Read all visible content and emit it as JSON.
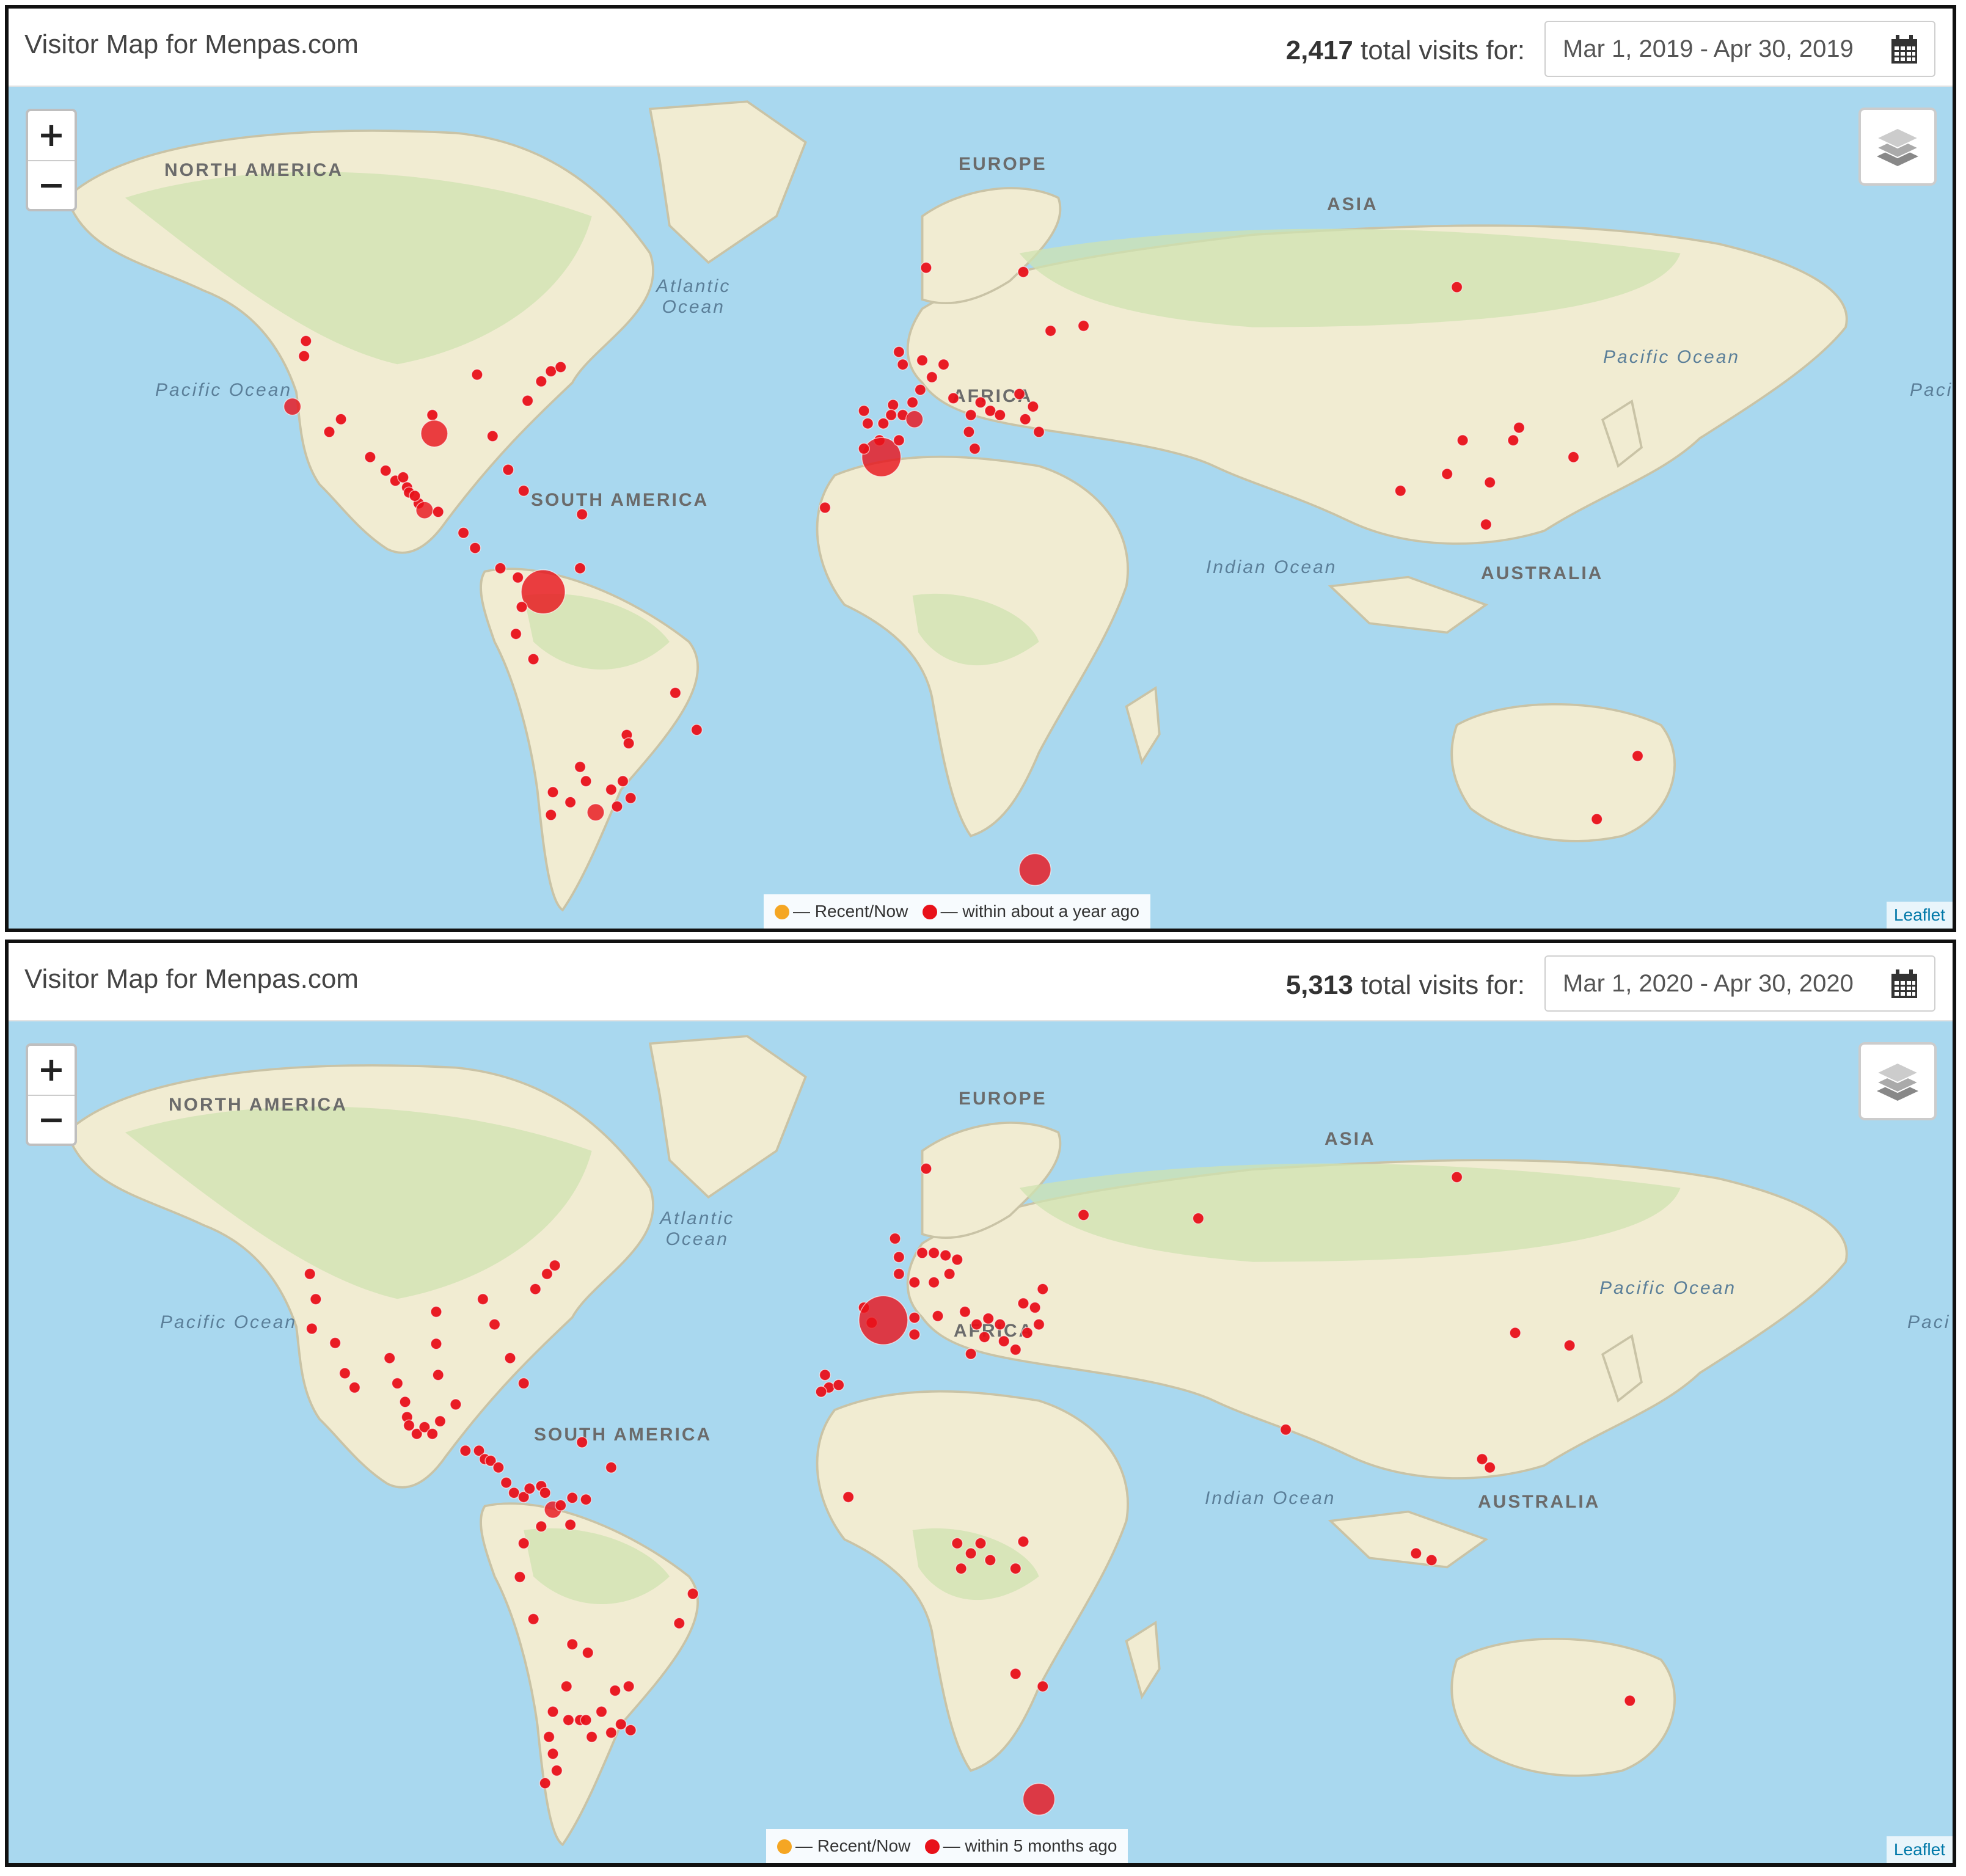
{
  "panels": [
    {
      "title": "Visitor Map for Menpas.com",
      "visits_count": "2,417",
      "visits_suffix": "total visits for:",
      "date_range": "Mar 1, 2019 - Apr 30, 2019",
      "legend": {
        "recent": "— Recent/Now",
        "older": "— within about a year ago"
      },
      "attribution": "Leaflet",
      "markers": [
        [
          0.152,
          0.32,
          1
        ],
        [
          0.153,
          0.302,
          1
        ],
        [
          0.146,
          0.38,
          2
        ],
        [
          0.171,
          0.395,
          1
        ],
        [
          0.165,
          0.41,
          1
        ],
        [
          0.186,
          0.44,
          1
        ],
        [
          0.194,
          0.456,
          1
        ],
        [
          0.199,
          0.468,
          1
        ],
        [
          0.203,
          0.464,
          1
        ],
        [
          0.205,
          0.476,
          1
        ],
        [
          0.206,
          0.482,
          1
        ],
        [
          0.211,
          0.495,
          1
        ],
        [
          0.214,
          0.503,
          2
        ],
        [
          0.209,
          0.486,
          1
        ],
        [
          0.221,
          0.505,
          1
        ],
        [
          0.218,
          0.39,
          1
        ],
        [
          0.219,
          0.412,
          3
        ],
        [
          0.241,
          0.342,
          1
        ],
        [
          0.249,
          0.415,
          1
        ],
        [
          0.257,
          0.455,
          1
        ],
        [
          0.267,
          0.373,
          1
        ],
        [
          0.274,
          0.35,
          1
        ],
        [
          0.279,
          0.338,
          1
        ],
        [
          0.284,
          0.333,
          1
        ],
        [
          0.265,
          0.48,
          1
        ],
        [
          0.295,
          0.508,
          1
        ],
        [
          0.234,
          0.53,
          1
        ],
        [
          0.24,
          0.548,
          1
        ],
        [
          0.253,
          0.572,
          1
        ],
        [
          0.262,
          0.583,
          1
        ],
        [
          0.275,
          0.6,
          5
        ],
        [
          0.264,
          0.618,
          1
        ],
        [
          0.261,
          0.65,
          1
        ],
        [
          0.294,
          0.572,
          1
        ],
        [
          0.27,
          0.68,
          1
        ],
        [
          0.343,
          0.72,
          1
        ],
        [
          0.354,
          0.764,
          1
        ],
        [
          0.318,
          0.77,
          1
        ],
        [
          0.319,
          0.78,
          1
        ],
        [
          0.297,
          0.825,
          1
        ],
        [
          0.289,
          0.85,
          1
        ],
        [
          0.294,
          0.808,
          1
        ],
        [
          0.279,
          0.865,
          1
        ],
        [
          0.302,
          0.862,
          2
        ],
        [
          0.31,
          0.835,
          1
        ],
        [
          0.313,
          0.855,
          1
        ],
        [
          0.32,
          0.845,
          1
        ],
        [
          0.316,
          0.825,
          1
        ],
        [
          0.28,
          0.838,
          1
        ],
        [
          0.472,
          0.215,
          1
        ],
        [
          0.458,
          0.315,
          1
        ],
        [
          0.46,
          0.33,
          1
        ],
        [
          0.47,
          0.325,
          1
        ],
        [
          0.481,
          0.33,
          1
        ],
        [
          0.475,
          0.345,
          1
        ],
        [
          0.469,
          0.36,
          1
        ],
        [
          0.465,
          0.375,
          1
        ],
        [
          0.455,
          0.378,
          1
        ],
        [
          0.44,
          0.385,
          1
        ],
        [
          0.442,
          0.4,
          1
        ],
        [
          0.45,
          0.4,
          1
        ],
        [
          0.454,
          0.39,
          1
        ],
        [
          0.46,
          0.39,
          1
        ],
        [
          0.466,
          0.395,
          2
        ],
        [
          0.448,
          0.42,
          1
        ],
        [
          0.449,
          0.44,
          6
        ],
        [
          0.44,
          0.43,
          1
        ],
        [
          0.458,
          0.42,
          1
        ],
        [
          0.42,
          0.5,
          1
        ],
        [
          0.486,
          0.37,
          1
        ],
        [
          0.495,
          0.39,
          1
        ],
        [
          0.5,
          0.375,
          1
        ],
        [
          0.505,
          0.385,
          1
        ],
        [
          0.51,
          0.39,
          1
        ],
        [
          0.52,
          0.365,
          1
        ],
        [
          0.527,
          0.38,
          1
        ],
        [
          0.523,
          0.395,
          1
        ],
        [
          0.536,
          0.29,
          1
        ],
        [
          0.522,
          0.22,
          1
        ],
        [
          0.494,
          0.41,
          1
        ],
        [
          0.497,
          0.43,
          1
        ],
        [
          0.53,
          0.41,
          1
        ],
        [
          0.553,
          0.284,
          1
        ],
        [
          0.745,
          0.238,
          1
        ],
        [
          0.777,
          0.405,
          1
        ],
        [
          0.748,
          0.42,
          1
        ],
        [
          0.716,
          0.48,
          1
        ],
        [
          0.74,
          0.46,
          1
        ],
        [
          0.762,
          0.47,
          1
        ],
        [
          0.76,
          0.52,
          1
        ],
        [
          0.774,
          0.42,
          1
        ],
        [
          0.805,
          0.44,
          1
        ],
        [
          0.838,
          0.795,
          1
        ],
        [
          0.817,
          0.87,
          1
        ],
        [
          0.528,
          0.93,
          4
        ]
      ]
    },
    {
      "title": "Visitor Map for Menpas.com",
      "visits_count": "5,313",
      "visits_suffix": "total visits for:",
      "date_range": "Mar 1, 2020 - Apr 30, 2020",
      "legend": {
        "recent": "— Recent/Now",
        "older": "— within 5 months ago"
      },
      "attribution": "Leaflet",
      "markers": [
        [
          0.155,
          0.3,
          1
        ],
        [
          0.158,
          0.33,
          1
        ],
        [
          0.156,
          0.365,
          1
        ],
        [
          0.168,
          0.382,
          1
        ],
        [
          0.173,
          0.418,
          1
        ],
        [
          0.178,
          0.435,
          1
        ],
        [
          0.196,
          0.4,
          1
        ],
        [
          0.2,
          0.43,
          1
        ],
        [
          0.204,
          0.452,
          1
        ],
        [
          0.205,
          0.47,
          1
        ],
        [
          0.206,
          0.48,
          1
        ],
        [
          0.21,
          0.49,
          1
        ],
        [
          0.214,
          0.482,
          1
        ],
        [
          0.218,
          0.49,
          1
        ],
        [
          0.222,
          0.475,
          1
        ],
        [
          0.22,
          0.345,
          1
        ],
        [
          0.22,
          0.383,
          1
        ],
        [
          0.221,
          0.42,
          1
        ],
        [
          0.244,
          0.33,
          1
        ],
        [
          0.25,
          0.36,
          1
        ],
        [
          0.258,
          0.4,
          1
        ],
        [
          0.265,
          0.43,
          1
        ],
        [
          0.271,
          0.318,
          1
        ],
        [
          0.277,
          0.3,
          1
        ],
        [
          0.281,
          0.29,
          1
        ],
        [
          0.23,
          0.455,
          1
        ],
        [
          0.235,
          0.51,
          1
        ],
        [
          0.242,
          0.51,
          1
        ],
        [
          0.245,
          0.52,
          1
        ],
        [
          0.248,
          0.522,
          1
        ],
        [
          0.252,
          0.53,
          1
        ],
        [
          0.256,
          0.548,
          1
        ],
        [
          0.26,
          0.56,
          1
        ],
        [
          0.265,
          0.565,
          1
        ],
        [
          0.268,
          0.555,
          1
        ],
        [
          0.274,
          0.552,
          1
        ],
        [
          0.276,
          0.56,
          1
        ],
        [
          0.28,
          0.58,
          2
        ],
        [
          0.284,
          0.575,
          1
        ],
        [
          0.29,
          0.566,
          1
        ],
        [
          0.297,
          0.568,
          1
        ],
        [
          0.295,
          0.5,
          1
        ],
        [
          0.31,
          0.53,
          1
        ],
        [
          0.289,
          0.598,
          1
        ],
        [
          0.274,
          0.6,
          1
        ],
        [
          0.265,
          0.62,
          1
        ],
        [
          0.263,
          0.66,
          1
        ],
        [
          0.27,
          0.71,
          1
        ],
        [
          0.345,
          0.715,
          1
        ],
        [
          0.352,
          0.68,
          1
        ],
        [
          0.29,
          0.74,
          1
        ],
        [
          0.298,
          0.75,
          1
        ],
        [
          0.287,
          0.79,
          1
        ],
        [
          0.28,
          0.82,
          1
        ],
        [
          0.288,
          0.83,
          1
        ],
        [
          0.294,
          0.83,
          1
        ],
        [
          0.297,
          0.83,
          1
        ],
        [
          0.305,
          0.82,
          1
        ],
        [
          0.31,
          0.845,
          1
        ],
        [
          0.315,
          0.835,
          1
        ],
        [
          0.32,
          0.842,
          1
        ],
        [
          0.312,
          0.795,
          1
        ],
        [
          0.319,
          0.79,
          1
        ],
        [
          0.278,
          0.85,
          1
        ],
        [
          0.28,
          0.87,
          1
        ],
        [
          0.3,
          0.85,
          1
        ],
        [
          0.276,
          0.905,
          1
        ],
        [
          0.282,
          0.89,
          1
        ],
        [
          0.472,
          0.175,
          1
        ],
        [
          0.456,
          0.258,
          1
        ],
        [
          0.458,
          0.28,
          1
        ],
        [
          0.47,
          0.275,
          1
        ],
        [
          0.476,
          0.275,
          1
        ],
        [
          0.482,
          0.278,
          1
        ],
        [
          0.488,
          0.283,
          1
        ],
        [
          0.484,
          0.3,
          1
        ],
        [
          0.476,
          0.31,
          1
        ],
        [
          0.466,
          0.31,
          1
        ],
        [
          0.458,
          0.3,
          1
        ],
        [
          0.44,
          0.34,
          1
        ],
        [
          0.444,
          0.358,
          1
        ],
        [
          0.45,
          0.355,
          7
        ],
        [
          0.466,
          0.352,
          1
        ],
        [
          0.478,
          0.35,
          1
        ],
        [
          0.466,
          0.372,
          1
        ],
        [
          0.492,
          0.345,
          1
        ],
        [
          0.498,
          0.36,
          1
        ],
        [
          0.504,
          0.353,
          1
        ],
        [
          0.51,
          0.36,
          1
        ],
        [
          0.512,
          0.38,
          1
        ],
        [
          0.522,
          0.335,
          1
        ],
        [
          0.528,
          0.34,
          1
        ],
        [
          0.53,
          0.36,
          1
        ],
        [
          0.524,
          0.37,
          1
        ],
        [
          0.532,
          0.318,
          1
        ],
        [
          0.502,
          0.375,
          1
        ],
        [
          0.495,
          0.395,
          1
        ],
        [
          0.518,
          0.39,
          1
        ],
        [
          0.553,
          0.23,
          1
        ],
        [
          0.612,
          0.234,
          1
        ],
        [
          0.745,
          0.185,
          1
        ],
        [
          0.775,
          0.37,
          1
        ],
        [
          0.803,
          0.385,
          1
        ],
        [
          0.42,
          0.42,
          1
        ],
        [
          0.422,
          0.435,
          1
        ],
        [
          0.427,
          0.432,
          1
        ],
        [
          0.418,
          0.44,
          1
        ],
        [
          0.432,
          0.565,
          1
        ],
        [
          0.488,
          0.62,
          1
        ],
        [
          0.495,
          0.632,
          1
        ],
        [
          0.5,
          0.62,
          1
        ],
        [
          0.49,
          0.65,
          1
        ],
        [
          0.505,
          0.64,
          1
        ],
        [
          0.522,
          0.618,
          1
        ],
        [
          0.518,
          0.65,
          1
        ],
        [
          0.518,
          0.775,
          1
        ],
        [
          0.532,
          0.79,
          1
        ],
        [
          0.657,
          0.485,
          1
        ],
        [
          0.758,
          0.52,
          1
        ],
        [
          0.762,
          0.53,
          1
        ],
        [
          0.724,
          0.632,
          1
        ],
        [
          0.732,
          0.64,
          1
        ],
        [
          0.834,
          0.807,
          1
        ],
        [
          0.53,
          0.924,
          4
        ]
      ]
    }
  ]
}
